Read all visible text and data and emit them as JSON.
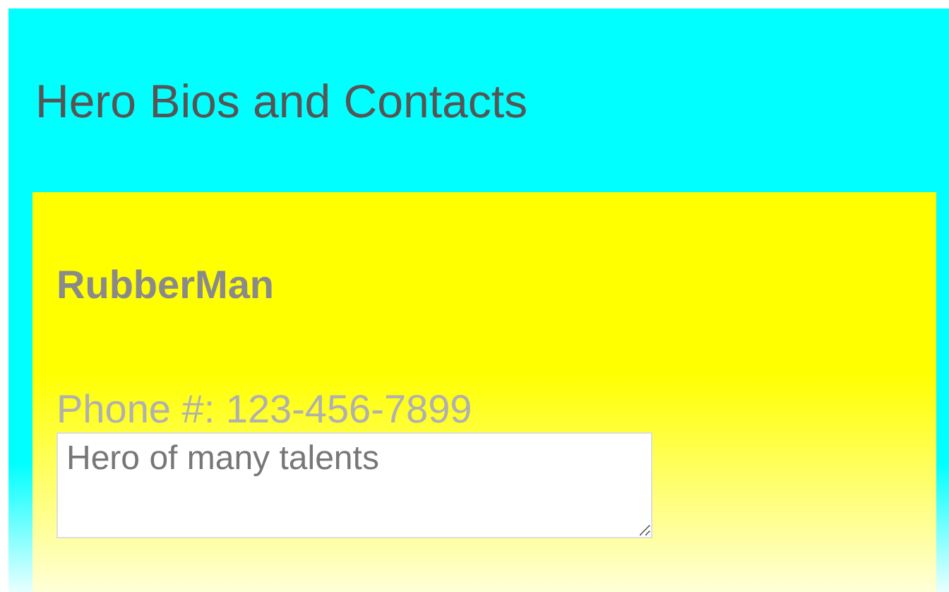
{
  "title": "Hero Bios and Contacts",
  "hero": {
    "name": "RubberMan",
    "phone": "Phone #: 123-456-7899",
    "bio": "Hero of many talents"
  }
}
